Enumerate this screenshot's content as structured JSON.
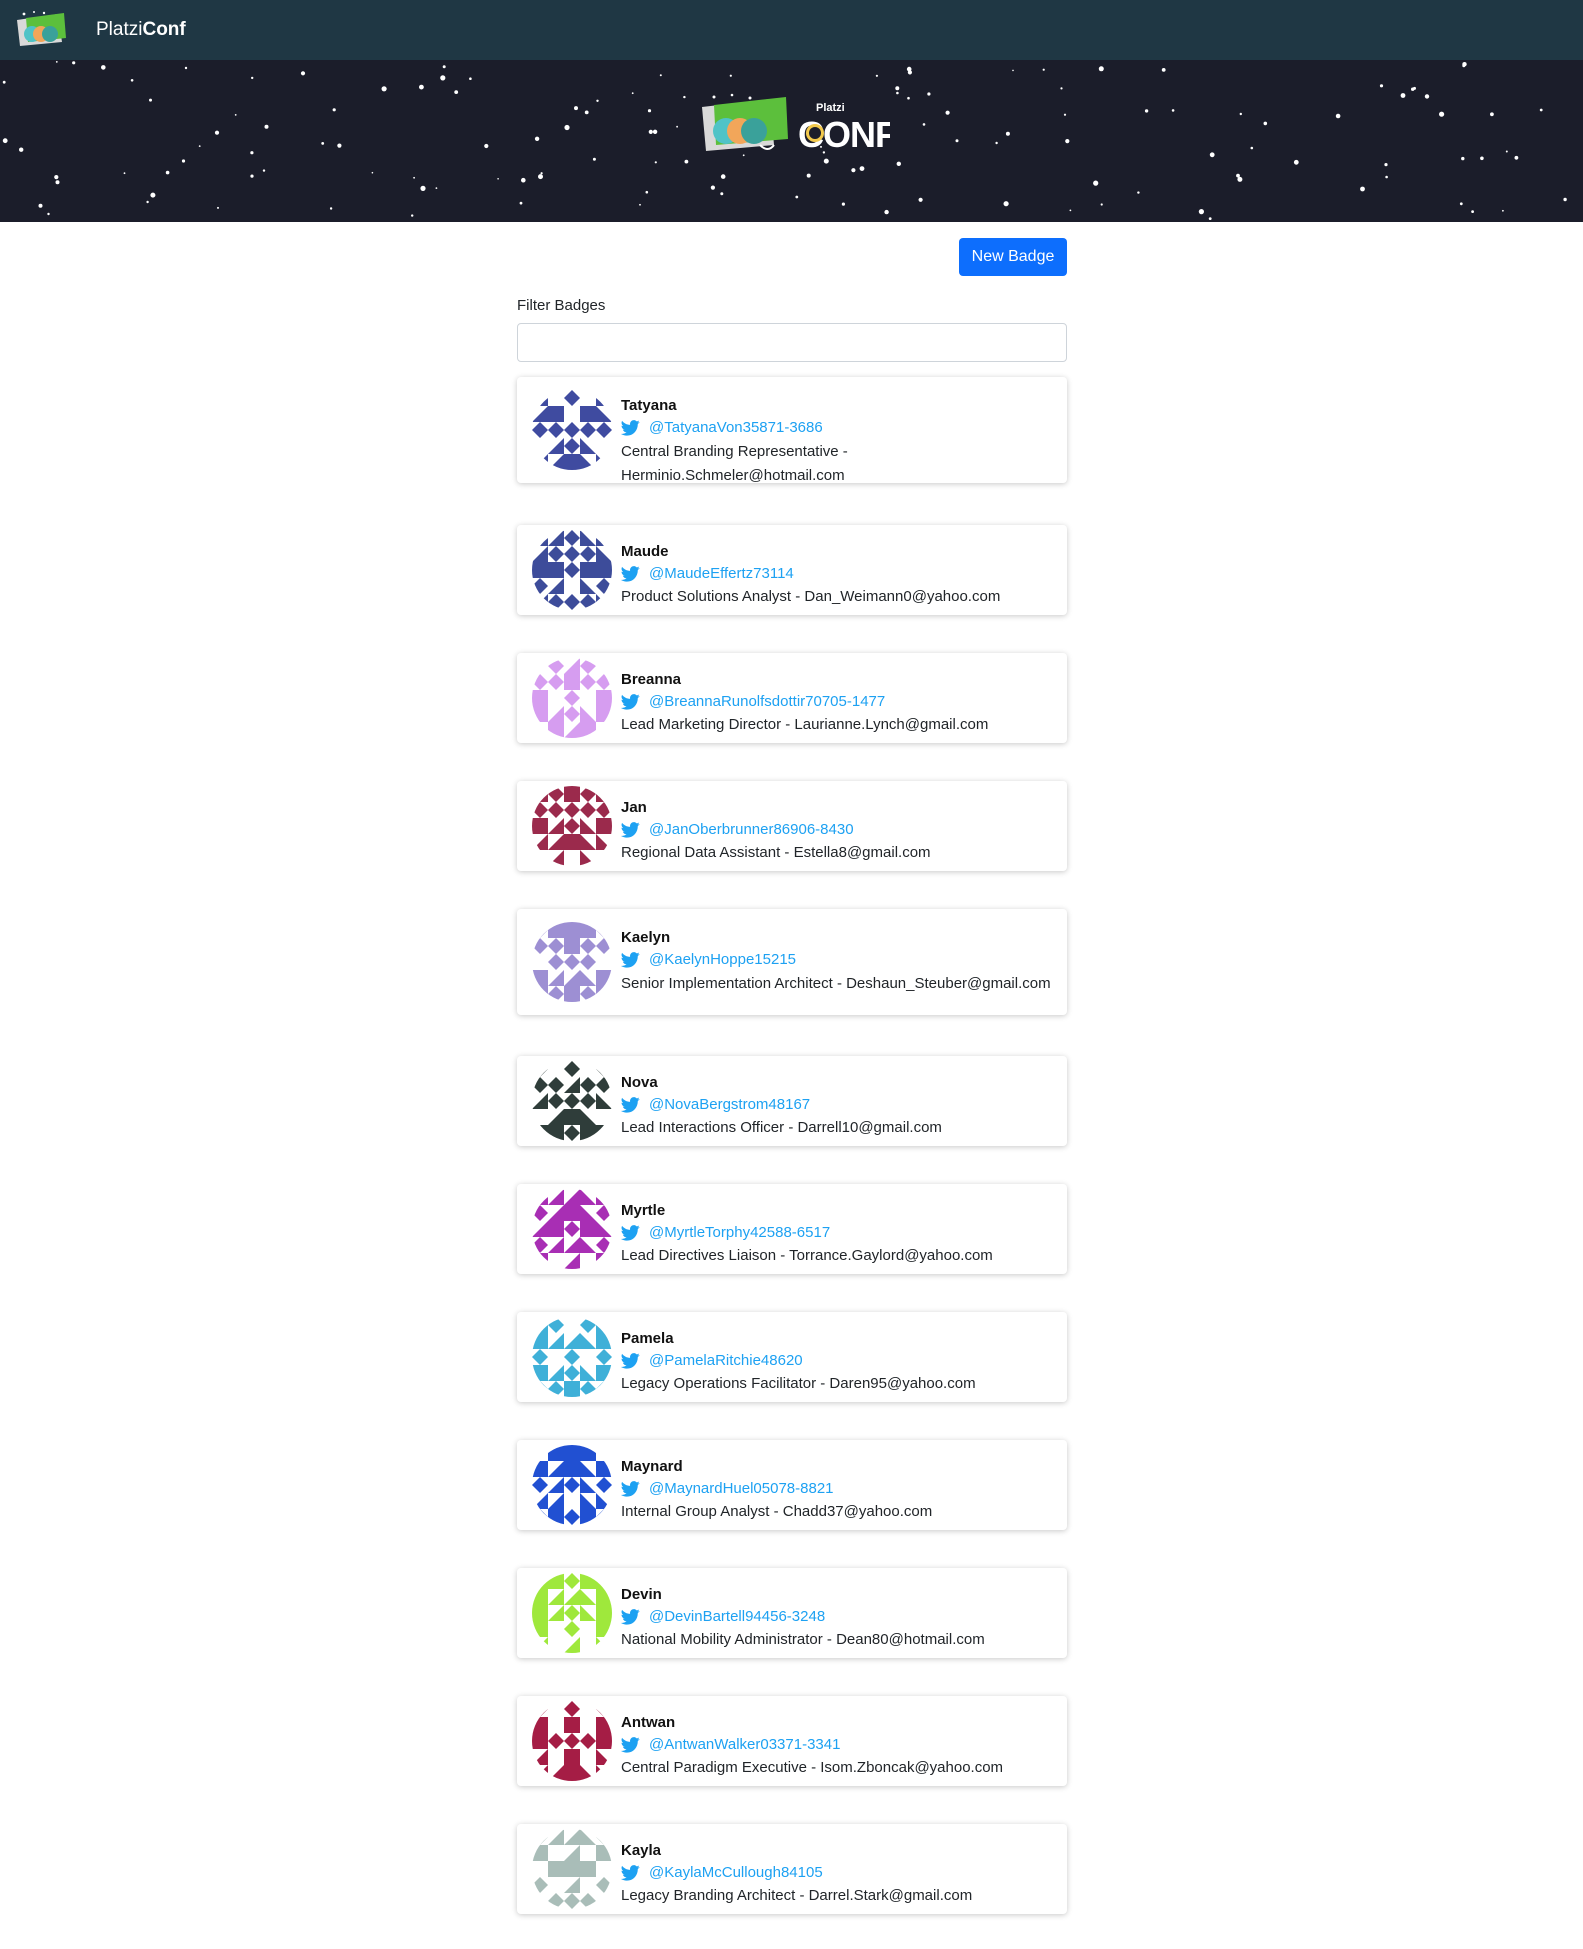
{
  "navbar": {
    "brand_light": "Platzi",
    "brand_bold": "Conf",
    "logo_icon": "platziconf-logo-icon"
  },
  "hero": {
    "logo_icon": "platziconf-conf-logo-icon"
  },
  "actions": {
    "new_badge_label": "New Badge"
  },
  "filter": {
    "label": "Filter Badges",
    "value": "",
    "placeholder": ""
  },
  "colors": {
    "accent": "#0d6efd",
    "twitter": "#1da1f2",
    "navbar": "#1f3744",
    "hero": "#1b1d2a"
  },
  "badges": [
    {
      "name": "Tatyana",
      "twitter": "@TatyanaVon35871-3686",
      "description": "Central Branding Representative - Herminio.Schmeler@hotmail.com",
      "avatar_color": "#3f4ba0"
    },
    {
      "name": "Maude",
      "twitter": "@MaudeEffertz73114",
      "description": "Product Solutions Analyst - Dan_Weimann0@yahoo.com",
      "avatar_color": "#3d4c9a"
    },
    {
      "name": "Breanna",
      "twitter": "@BreannaRunolfsdottir70705-1477",
      "description": "Lead Marketing Director - Laurianne.Lynch@gmail.com",
      "avatar_color": "#d69df0"
    },
    {
      "name": "Jan",
      "twitter": "@JanOberbrunner86906-8430",
      "description": "Regional Data Assistant - Estella8@gmail.com",
      "avatar_color": "#9b2a4c"
    },
    {
      "name": "Kaelyn",
      "twitter": "@KaelynHoppe15215",
      "description": "Senior Implementation Architect - Deshaun_Steuber@gmail.com",
      "avatar_color": "#9d8fd3"
    },
    {
      "name": "Nova",
      "twitter": "@NovaBergstrom48167",
      "description": "Lead Interactions Officer - Darrell10@gmail.com",
      "avatar_color": "#2f3d3a"
    },
    {
      "name": "Myrtle",
      "twitter": "@MyrtleTorphy42588-6517",
      "description": "Lead Directives Liaison - Torrance.Gaylord@yahoo.com",
      "avatar_color": "#a82eb4"
    },
    {
      "name": "Pamela",
      "twitter": "@PamelaRitchie48620",
      "description": "Legacy Operations Facilitator - Daren95@yahoo.com",
      "avatar_color": "#3fb0d8"
    },
    {
      "name": "Maynard",
      "twitter": "@MaynardHuel05078-8821",
      "description": "Internal Group Analyst - Chadd37@yahoo.com",
      "avatar_color": "#2150d2"
    },
    {
      "name": "Devin",
      "twitter": "@DevinBartell94456-3248",
      "description": "National Mobility Administrator - Dean80@hotmail.com",
      "avatar_color": "#9fe83c"
    },
    {
      "name": "Antwan",
      "twitter": "@AntwanWalker03371-3341",
      "description": "Central Paradigm Executive - Isom.Zboncak@yahoo.com",
      "avatar_color": "#a51d45"
    },
    {
      "name": "Kayla",
      "twitter": "@KaylaMcCullough84105",
      "description": "Legacy Branding Architect - Darrel.Stark@gmail.com",
      "avatar_color": "#a9bdb8"
    }
  ]
}
